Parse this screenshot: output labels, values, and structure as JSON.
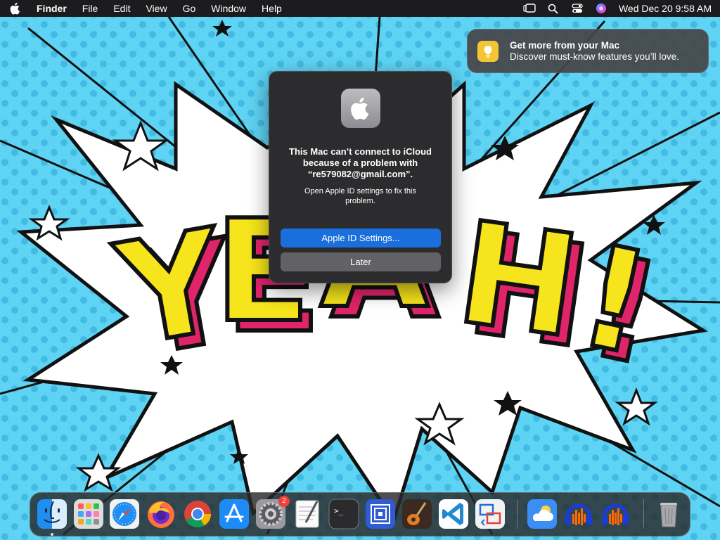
{
  "menubar": {
    "app_name": "Finder",
    "menus": [
      "File",
      "Edit",
      "View",
      "Go",
      "Window",
      "Help"
    ],
    "clock": "Wed Dec 20  9:58 AM",
    "status_icons": [
      "stage-manager-icon",
      "spotlight-icon",
      "control-center-icon",
      "siri-icon"
    ]
  },
  "notification": {
    "title": "Get more from your Mac",
    "body": "Discover must-know features you’ll love.",
    "icon": "tips-icon",
    "accent": "#f4c634"
  },
  "dialog": {
    "title": "This Mac can’t connect to iCloud because of a problem with “re579082@gmail.com”.",
    "body": "Open Apple ID settings to fix this problem.",
    "primary_button": "Apple ID Settings...",
    "secondary_button": "Later",
    "primary_color": "#1a6fdc"
  },
  "dock": {
    "items": [
      {
        "name": "finder",
        "icon": "finder-icon"
      },
      {
        "name": "launchpad",
        "icon": "launchpad-icon"
      },
      {
        "name": "safari",
        "icon": "safari-icon"
      },
      {
        "name": "firefox",
        "icon": "firefox-icon"
      },
      {
        "name": "chrome",
        "icon": "chrome-icon"
      },
      {
        "name": "app-store",
        "icon": "app-store-icon"
      },
      {
        "name": "system-settings",
        "icon": "gear-icon",
        "badge": "2"
      },
      {
        "name": "textedit",
        "icon": "textedit-icon"
      },
      {
        "name": "terminal",
        "icon": "terminal-icon"
      },
      {
        "name": "remote-desktop",
        "icon": "remote-desktop-icon"
      },
      {
        "name": "garageband",
        "icon": "guitar-icon"
      },
      {
        "name": "vscode",
        "icon": "vscode-icon"
      },
      {
        "name": "migration",
        "icon": "migration-icon"
      },
      {
        "name": "weather",
        "icon": "weather-icon"
      },
      {
        "name": "audacity",
        "icon": "audacity-icon"
      },
      {
        "name": "audacity-2",
        "icon": "audacity-icon"
      },
      {
        "name": "trash",
        "icon": "trash-icon"
      }
    ]
  }
}
